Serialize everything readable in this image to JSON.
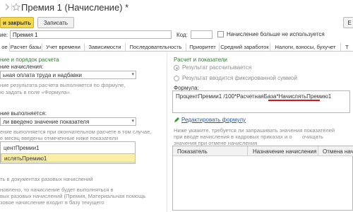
{
  "window": {
    "title": "Премия 1 (Начисление) *"
  },
  "toolbar": {
    "save_close": "и закрыть",
    "save": "Записать",
    "more": "Е"
  },
  "header": {
    "name_label": "ие:",
    "name_value": "Премия 1",
    "code_label": "Код:",
    "code_value": "",
    "unused_label": "Начисление больше не используется"
  },
  "tabs": [
    {
      "label": "ое"
    },
    {
      "label": "Расчет базы"
    },
    {
      "label": "Учет времени"
    },
    {
      "label": "Зависимости"
    },
    {
      "label": "Последовательность"
    },
    {
      "label": "Приоритет"
    },
    {
      "label": "Средний заработок"
    },
    {
      "label": "Налоги, взносы, бухучет"
    },
    {
      "label": "Т"
    }
  ],
  "left": {
    "section_title": "ние и порядок расчета",
    "purpose_label": "ние начисления:",
    "purpose_value": "ьная оплата труда и надбавки",
    "note1_line1": "ние результата расчета выполняется по формуле,",
    "note1_line2": "ю задать в поле «Формула».",
    "exec_label": "ние выполняется:",
    "exec_value": "ли введено значение показателя",
    "note2_line1": "ение выполняется при окончательном расчете в том случае,",
    "note2_line2": "е месяц введены отмеченные ниже показатели",
    "list": [
      "центПремии1",
      "ислятьПремию1"
    ],
    "docs_label": "ть в документах разовых начислений",
    "note3_line1": "новлено, то начисление будет выполняться в",
    "note3_line2": "вых разовых начислений (Премия, Материальная помощь",
    "note3_line3": "зовое начисление входит в базу текущего"
  },
  "right": {
    "section_title": "Расчет и показатели",
    "radio1": "Результат рассчитывается",
    "radio2": "Результат вводится фиксированной суммой",
    "formula_label": "Формула:",
    "formula_value": "ПроцентПремии1 /100*РасчетнаяБаза*НачислятьПремию1",
    "edit_link": "Редактировать формулу",
    "info_line1": "Ниже укажите, требуется ли запрашивать значения показателей",
    "info_line2": "при вводе начисления в кадровых приказах и о",
    "info_line2b": "очищать",
    "info_line3": "значения при отмене начисления",
    "table_headers": [
      "Показатель",
      "Назначение начисления",
      "Отмена нач"
    ]
  }
}
